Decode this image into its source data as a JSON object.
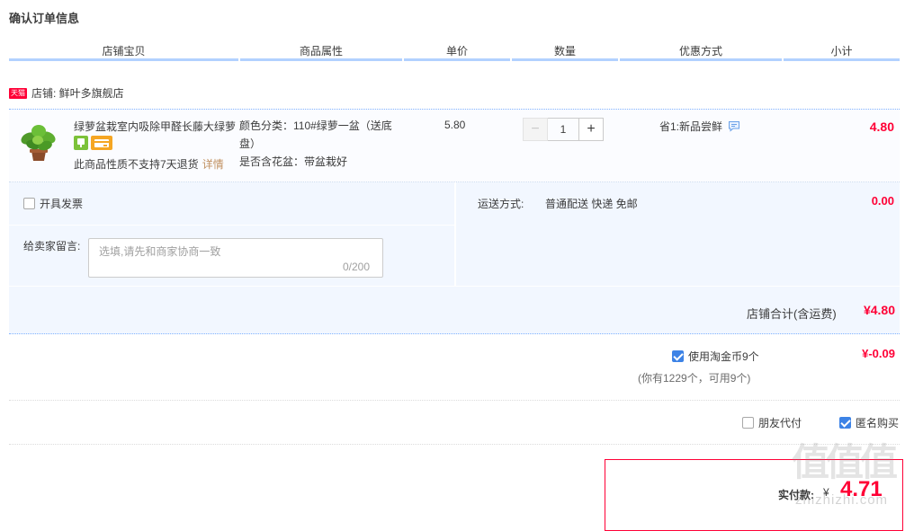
{
  "page_title": "确认订单信息",
  "columns": [
    "店铺宝贝",
    "商品属性",
    "单价",
    "数量",
    "优惠方式",
    "小计"
  ],
  "shop": {
    "badge": "天猫",
    "label": "店铺: 鲜叶多旗舰店"
  },
  "item": {
    "title": "绿萝盆栽室内吸除甲醛长藤大绿萝",
    "return_note": "此商品性质不支持7天退货",
    "detail_link": "详情",
    "attr_line1": "颜色分类：110#绿萝一盆（送底",
    "attr_line2": "盘）",
    "attr_line3": "是否含花盆：带盆栽好",
    "price": "5.80",
    "quantity": "1",
    "qty_minus": "−",
    "qty_plus": "+",
    "promo": "省1:新品尝鲜",
    "subtotal": "4.80"
  },
  "invoice": {
    "label": "开具发票",
    "checked": false
  },
  "message": {
    "label": "给卖家留言:",
    "placeholder": "选填,请先和商家协商一致",
    "count": "0/200"
  },
  "shipping": {
    "label": "运送方式:",
    "value": "普通配送 快递 免邮",
    "price": "0.00"
  },
  "shop_total": {
    "label": "店铺合计(含运费)",
    "value": "¥4.80"
  },
  "coins": {
    "label": "使用淘金币9个",
    "note": "(你有1229个，可用9个)",
    "value": "¥-0.09",
    "checked": true
  },
  "options": {
    "friend_pay": "朋友代付",
    "anonymous": "匿名购买"
  },
  "payment": {
    "label": "实付款:",
    "currency": "¥",
    "value": "4.71"
  },
  "watermark": {
    "main": "值值值",
    "sub": "zhizhizhi.com"
  },
  "colors": {
    "accent_red": "#ff0036",
    "accent_blue": "#3d83e6",
    "band_blue": "#f2f7ff",
    "header_rule": "#b2d1ff"
  }
}
